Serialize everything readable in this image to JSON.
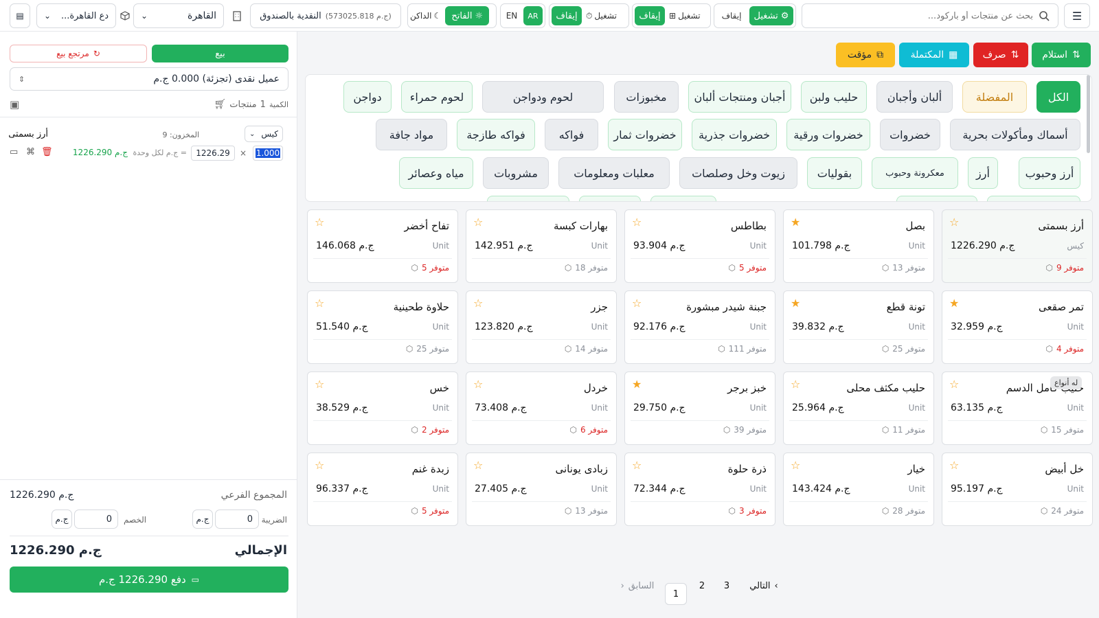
{
  "topbar": {
    "search_placeholder": "بحث عن منتجات أو باركود...",
    "toggle1": {
      "on_label": "تشغيل",
      "off_label": "إيقاف"
    },
    "toggle2": {
      "on_label": "تشغيل",
      "off_label": "إيقاف"
    },
    "toggle3": {
      "on_label": "تشغيل",
      "off_label": "إيقاف"
    },
    "lang": {
      "en": "EN",
      "ar": "AR"
    },
    "theme": {
      "light": "الفاتح",
      "dark": "الداكن"
    },
    "cashbox": {
      "label": "النقدية بالصندوق",
      "amount": "(573025.818 ج.م)"
    },
    "branch": "القاهرة",
    "warehouse": "...دع القاهرة"
  },
  "actions": {
    "receive": "استلام",
    "spend": "صرف",
    "completed": "المكتملة",
    "temp": "مؤقت"
  },
  "categories": [
    {
      "label": "الكل",
      "style": "active"
    },
    {
      "label": "المفضلة",
      "style": "fav"
    },
    {
      "label": "ألبان وأجبان",
      "style": "sub"
    },
    {
      "label": "حليب ولبن",
      "style": "leaf"
    },
    {
      "label": "أجبان ومنتجات ألبان",
      "style": "leaf"
    },
    {
      "label": "مخبوزات",
      "style": "sub"
    },
    {
      "label": "لحوم ودواجن",
      "style": "sub"
    },
    {
      "label": "لحوم حمراء",
      "style": "leaf"
    },
    {
      "label": "دواجن",
      "style": "leaf"
    },
    {
      "label": "أسماك ومأكولات بحرية",
      "style": "sub"
    },
    {
      "label": "خضروات",
      "style": "sub"
    },
    {
      "label": "خضروات ورقية",
      "style": "leaf"
    },
    {
      "label": "خضروات جذرية",
      "style": "leaf"
    },
    {
      "label": "خضروات ثمار",
      "style": "leaf"
    },
    {
      "label": "فواكه",
      "style": "sub"
    },
    {
      "label": "فواكه طازجة",
      "style": "leaf"
    },
    {
      "label": "مواد جافة",
      "style": "sub"
    },
    {
      "label": "أرز وحبوب",
      "style": "leaf"
    },
    {
      "label": "أرز",
      "style": "leaf"
    },
    {
      "label": "معكرونة وحبوب",
      "style": "leaf"
    },
    {
      "label": "بقوليات",
      "style": "leaf"
    },
    {
      "label": "زيوت وخل وصلصات",
      "style": "sub"
    },
    {
      "label": "معلبات ومعلومات",
      "style": "sub"
    },
    {
      "label": "مشروبات",
      "style": "sub"
    },
    {
      "label": "مياه وعصائر",
      "style": "leaf"
    }
  ],
  "products": [
    {
      "name": "أرز بسمتى",
      "unit": "كيس",
      "price": "1226.290 ج.م",
      "stock": "9 متوفر",
      "low": true,
      "fav": false
    },
    {
      "name": "بصل",
      "unit": "Unit",
      "price": "101.798 ج.م",
      "stock": "13 متوفر",
      "low": false,
      "fav": true
    },
    {
      "name": "بطاطس",
      "unit": "Unit",
      "price": "93.904 ج.م",
      "stock": "5 متوفر",
      "low": true,
      "fav": false
    },
    {
      "name": "بهارات كبسة",
      "unit": "Unit",
      "price": "142.951 ج.م",
      "stock": "18 متوفر",
      "low": false,
      "fav": false
    },
    {
      "name": "تفاح أخضر",
      "unit": "Unit",
      "price": "146.068 ج.م",
      "stock": "5 متوفر",
      "low": true,
      "fav": false
    },
    {
      "name": "تمر صقعى",
      "unit": "Unit",
      "price": "32.959 ج.م",
      "stock": "4 متوفر",
      "low": true,
      "fav": true
    },
    {
      "name": "تونة قطع",
      "unit": "Unit",
      "price": "39.832 ج.م",
      "stock": "25 متوفر",
      "low": false,
      "fav": true
    },
    {
      "name": "جبنة شيدر مبشورة",
      "unit": "Unit",
      "price": "92.176 ج.م",
      "stock": "111 متوفر",
      "low": false,
      "fav": false
    },
    {
      "name": "جزر",
      "unit": "Unit",
      "price": "123.820 ج.م",
      "stock": "14 متوفر",
      "low": false,
      "fav": false
    },
    {
      "name": "حلاوة طحينية",
      "unit": "Unit",
      "price": "51.540 ج.م",
      "stock": "25 متوفر",
      "low": false,
      "fav": false
    },
    {
      "name": "حليب كامل الدسم",
      "unit": "Unit",
      "price": "63.135 ج.م",
      "stock": "15 متوفر",
      "low": false,
      "fav": false
    },
    {
      "name": "حليب مكثف محلى",
      "unit": "Unit",
      "price": "25.964 ج.م",
      "stock": "11 متوفر",
      "low": false,
      "fav": false
    },
    {
      "name": "خبز برجر",
      "unit": "Unit",
      "price": "29.750 ج.م",
      "stock": "39 متوفر",
      "low": false,
      "fav": true
    },
    {
      "name": "خردل",
      "unit": "Unit",
      "price": "73.408 ج.م",
      "stock": "6 متوفر",
      "low": true,
      "fav": false
    },
    {
      "name": "خس",
      "unit": "Unit",
      "price": "38.529 ج.م",
      "stock": "2 متوفر",
      "low": true,
      "fav": false
    },
    {
      "name": "خل أبيض",
      "unit": "Unit",
      "price": "95.197 ج.م",
      "stock": "24 متوفر",
      "low": false,
      "fav": false
    },
    {
      "name": "خيار",
      "unit": "Unit",
      "price": "143.424 ج.م",
      "stock": "28 متوفر",
      "low": false,
      "fav": false
    },
    {
      "name": "ذرة حلوة",
      "unit": "Unit",
      "price": "72.344 ج.م",
      "stock": "3 متوفر",
      "low": true,
      "fav": false
    },
    {
      "name": "زبادى يونانى",
      "unit": "Unit",
      "price": "27.405 ج.م",
      "stock": "13 متوفر",
      "low": false,
      "fav": false
    },
    {
      "name": "زبدة غنم",
      "unit": "Unit",
      "price": "96.337 ج.م",
      "stock": "5 متوفر",
      "low": true,
      "fav": false
    }
  ],
  "variants_badge": "له أنواع",
  "pagination": {
    "next": "التالي",
    "prev": "السابق",
    "pages": [
      "3",
      "2",
      "1"
    ]
  },
  "cart": {
    "sale_tab": "بيع",
    "return_tab": "مرتجع بيع",
    "customer": "عميل نقدى (تجزئة) 0.000 ج.م",
    "qty_label": "الكمية",
    "qty_value": "1",
    "products_label": "منتجات",
    "item": {
      "name": "أرز بسمتى",
      "stock": "المخزون: 9",
      "unit": "كيس",
      "qty": "1.000",
      "times": "×",
      "unit_price": "1226.29",
      "per_unit": "ج.م لكل وحدة =",
      "line_total": "1226.290 ج.م"
    },
    "subtotal_label": "المجموع الفرعي",
    "subtotal": "1226.290 ج.م",
    "tax_label": "الضريبة",
    "tax_value": "0",
    "discount_label": "الخصم",
    "discount_value": "0",
    "currency": "ج.م",
    "total_label": "الإجمالي",
    "total": "1226.290 ج.م",
    "pay_button": "دفع 1226.290 ج.م"
  }
}
